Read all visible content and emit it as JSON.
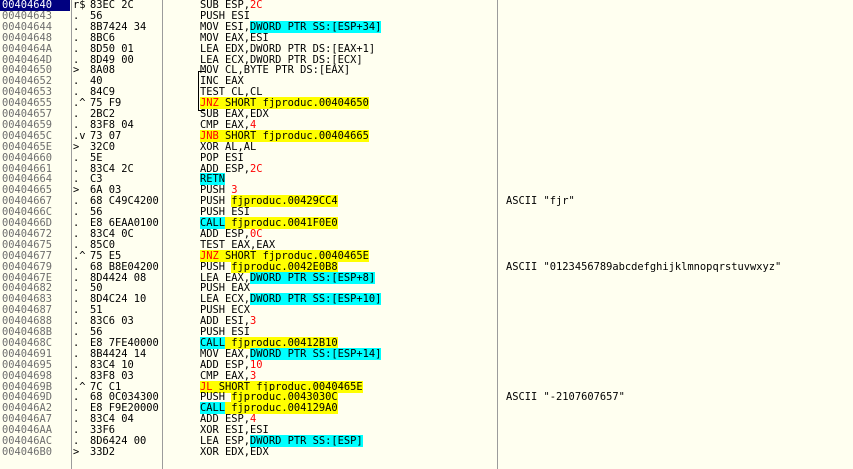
{
  "rows": [
    {
      "addr": "00404640",
      "gut": "r$",
      "hex": "83EC 2C",
      "asm": [
        {
          "t": "SUB ESP,"
        },
        {
          "t": "2C",
          "c": "const"
        }
      ],
      "cmt": "",
      "sel": true
    },
    {
      "addr": "00404643",
      "gut": ".",
      "hex": "56",
      "asm": [
        {
          "t": "PUSH ESI",
          "c": "plain"
        }
      ],
      "cmt": ""
    },
    {
      "addr": "00404644",
      "gut": ".",
      "hex": "8B7424 34",
      "asm": [
        {
          "t": "MOV ESI,"
        },
        {
          "t": "DWORD PTR SS:[ESP+34]",
          "c": "hl-cyan"
        }
      ],
      "cmt": ""
    },
    {
      "addr": "00404648",
      "gut": ".",
      "hex": "8BC6",
      "asm": [
        {
          "t": "MOV EAX,ESI"
        }
      ],
      "cmt": ""
    },
    {
      "addr": "0040464A",
      "gut": ".",
      "hex": "8D50 01",
      "asm": [
        {
          "t": "LEA EDX,DWORD PTR DS:[EAX+1]"
        }
      ],
      "cmt": ""
    },
    {
      "addr": "0040464D",
      "gut": ".",
      "hex": "8D49 00",
      "asm": [
        {
          "t": "LEA ECX,DWORD PTR DS:[ECX]"
        }
      ],
      "cmt": ""
    },
    {
      "addr": "00404650",
      "gut": ">",
      "hex": "8A08",
      "asm": [
        {
          "t": "MOV CL,BYTE PTR DS:[EAX]"
        }
      ],
      "cmt": ""
    },
    {
      "addr": "00404652",
      "gut": ".",
      "hex": "40",
      "asm": [
        {
          "t": "INC EAX"
        }
      ],
      "cmt": ""
    },
    {
      "addr": "00404653",
      "gut": ".",
      "hex": "84C9",
      "asm": [
        {
          "t": "TEST CL,CL"
        }
      ],
      "cmt": ""
    },
    {
      "addr": "00404655",
      "gut": ".^",
      "hex": "75 F9",
      "asm": [
        {
          "t": "JNZ",
          "c": "hl-red"
        },
        {
          "t": " SHORT fjproduc.00404650",
          "c": "hl"
        }
      ],
      "cmt": ""
    },
    {
      "addr": "00404657",
      "gut": ".",
      "hex": "2BC2",
      "asm": [
        {
          "t": "SUB EAX,EDX"
        }
      ],
      "cmt": ""
    },
    {
      "addr": "00404659",
      "gut": ".",
      "hex": "83F8 04",
      "asm": [
        {
          "t": "CMP EAX,"
        },
        {
          "t": "4",
          "c": "const"
        }
      ],
      "cmt": ""
    },
    {
      "addr": "0040465C",
      "gut": ".v",
      "hex": "73 07",
      "asm": [
        {
          "t": "JNB",
          "c": "hl-red"
        },
        {
          "t": " SHORT fjproduc.00404665",
          "c": "hl"
        }
      ],
      "cmt": ""
    },
    {
      "addr": "0040465E",
      "gut": ">",
      "hex": "32C0",
      "asm": [
        {
          "t": "XOR AL,AL"
        }
      ],
      "cmt": ""
    },
    {
      "addr": "00404660",
      "gut": ".",
      "hex": "5E",
      "asm": [
        {
          "t": "POP ESI"
        }
      ],
      "cmt": ""
    },
    {
      "addr": "00404661",
      "gut": ".",
      "hex": "83C4 2C",
      "asm": [
        {
          "t": "ADD ESP,"
        },
        {
          "t": "2C",
          "c": "const"
        }
      ],
      "cmt": ""
    },
    {
      "addr": "00404664",
      "gut": ".",
      "hex": "C3",
      "asm": [
        {
          "t": "RETN",
          "c": "hl-cyan"
        }
      ],
      "cmt": ""
    },
    {
      "addr": "00404665",
      "gut": ">",
      "hex": "6A 03",
      "asm": [
        {
          "t": "PUSH "
        },
        {
          "t": "3",
          "c": "const"
        }
      ],
      "cmt": ""
    },
    {
      "addr": "00404667",
      "gut": ".",
      "hex": "68 C49C4200",
      "asm": [
        {
          "t": "PUSH "
        },
        {
          "t": "fjproduc.00429CC4",
          "c": "hl"
        }
      ],
      "cmt": "ASCII \"fjr\""
    },
    {
      "addr": "0040466C",
      "gut": ".",
      "hex": "56",
      "asm": [
        {
          "t": "PUSH ESI"
        }
      ],
      "cmt": ""
    },
    {
      "addr": "0040466D",
      "gut": ".",
      "hex": "E8 6EAA0100",
      "asm": [
        {
          "t": "CALL",
          "c": "hl-cyan"
        },
        {
          "t": " fjproduc.0041F0E0",
          "c": "hl"
        }
      ],
      "cmt": ""
    },
    {
      "addr": "00404672",
      "gut": ".",
      "hex": "83C4 0C",
      "asm": [
        {
          "t": "ADD ESP,"
        },
        {
          "t": "0C",
          "c": "const"
        }
      ],
      "cmt": ""
    },
    {
      "addr": "00404675",
      "gut": ".",
      "hex": "85C0",
      "asm": [
        {
          "t": "TEST EAX,EAX"
        }
      ],
      "cmt": ""
    },
    {
      "addr": "00404677",
      "gut": ".^",
      "hex": "75 E5",
      "asm": [
        {
          "t": "JNZ",
          "c": "hl-red"
        },
        {
          "t": " SHORT fjproduc.0040465E",
          "c": "hl"
        }
      ],
      "cmt": ""
    },
    {
      "addr": "00404679",
      "gut": ".",
      "hex": "68 B8E04200",
      "asm": [
        {
          "t": "PUSH "
        },
        {
          "t": "fjproduc.0042E0B8",
          "c": "hl"
        }
      ],
      "cmt": "ASCII \"0123456789abcdefghijklmnopqrstuvwxyz\""
    },
    {
      "addr": "0040467E",
      "gut": ".",
      "hex": "8D4424 08",
      "asm": [
        {
          "t": "LEA EAX,"
        },
        {
          "t": "DWORD PTR SS:[ESP+8]",
          "c": "hl-cyan"
        }
      ],
      "cmt": ""
    },
    {
      "addr": "00404682",
      "gut": ".",
      "hex": "50",
      "asm": [
        {
          "t": "PUSH EAX"
        }
      ],
      "cmt": ""
    },
    {
      "addr": "00404683",
      "gut": ".",
      "hex": "8D4C24 10",
      "asm": [
        {
          "t": "LEA ECX,"
        },
        {
          "t": "DWORD PTR SS:[ESP+10]",
          "c": "hl-cyan"
        }
      ],
      "cmt": ""
    },
    {
      "addr": "00404687",
      "gut": ".",
      "hex": "51",
      "asm": [
        {
          "t": "PUSH ECX"
        }
      ],
      "cmt": ""
    },
    {
      "addr": "00404688",
      "gut": ".",
      "hex": "83C6 03",
      "asm": [
        {
          "t": "ADD ESI,"
        },
        {
          "t": "3",
          "c": "const"
        }
      ],
      "cmt": ""
    },
    {
      "addr": "0040468B",
      "gut": ".",
      "hex": "56",
      "asm": [
        {
          "t": "PUSH ESI"
        }
      ],
      "cmt": ""
    },
    {
      "addr": "0040468C",
      "gut": ".",
      "hex": "E8 7FE40000",
      "asm": [
        {
          "t": "CALL",
          "c": "hl-cyan"
        },
        {
          "t": " fjproduc.00412B10",
          "c": "hl"
        }
      ],
      "cmt": ""
    },
    {
      "addr": "00404691",
      "gut": ".",
      "hex": "8B4424 14",
      "asm": [
        {
          "t": "MOV EAX,"
        },
        {
          "t": "DWORD PTR SS:[ESP+14]",
          "c": "hl-cyan"
        }
      ],
      "cmt": ""
    },
    {
      "addr": "00404695",
      "gut": ".",
      "hex": "83C4 10",
      "asm": [
        {
          "t": "ADD ESP,"
        },
        {
          "t": "10",
          "c": "const"
        }
      ],
      "cmt": ""
    },
    {
      "addr": "00404698",
      "gut": ".",
      "hex": "83F8 03",
      "asm": [
        {
          "t": "CMP EAX,"
        },
        {
          "t": "3",
          "c": "const"
        }
      ],
      "cmt": ""
    },
    {
      "addr": "0040469B",
      "gut": ".^",
      "hex": "7C C1",
      "asm": [
        {
          "t": "JL",
          "c": "hl-red"
        },
        {
          "t": " SHORT fjproduc.0040465E",
          "c": "hl"
        }
      ],
      "cmt": ""
    },
    {
      "addr": "0040469D",
      "gut": ".",
      "hex": "68 0C034300",
      "asm": [
        {
          "t": "PUSH "
        },
        {
          "t": "fjproduc.0043030C",
          "c": "hl"
        }
      ],
      "cmt": "ASCII \"-2107607657\""
    },
    {
      "addr": "004046A2",
      "gut": ".",
      "hex": "E8 F9E20000",
      "asm": [
        {
          "t": "CALL",
          "c": "hl-cyan"
        },
        {
          "t": " fjproduc.004129A0",
          "c": "hl"
        }
      ],
      "cmt": ""
    },
    {
      "addr": "004046A7",
      "gut": ".",
      "hex": "83C4 04",
      "asm": [
        {
          "t": "ADD ESP,"
        },
        {
          "t": "4",
          "c": "const"
        }
      ],
      "cmt": ""
    },
    {
      "addr": "004046AA",
      "gut": ".",
      "hex": "33F6",
      "asm": [
        {
          "t": "XOR ESI,ESI"
        }
      ],
      "cmt": ""
    },
    {
      "addr": "004046AC",
      "gut": ".",
      "hex": "8D6424 00",
      "asm": [
        {
          "t": "LEA ESP,"
        },
        {
          "t": "DWORD PTR SS:[ESP]",
          "c": "hl-cyan"
        }
      ],
      "cmt": ""
    },
    {
      "addr": "004046B0",
      "gut": ">",
      "hex": "33D2",
      "asm": [
        {
          "t": "XOR EDX,EDX"
        }
      ],
      "cmt": ""
    }
  ],
  "colors": {
    "background": "#fffff0",
    "selection": "#000080",
    "jump_highlight": "#ffff00",
    "call_highlight": "#00ffff",
    "constant": "#ff0000"
  }
}
